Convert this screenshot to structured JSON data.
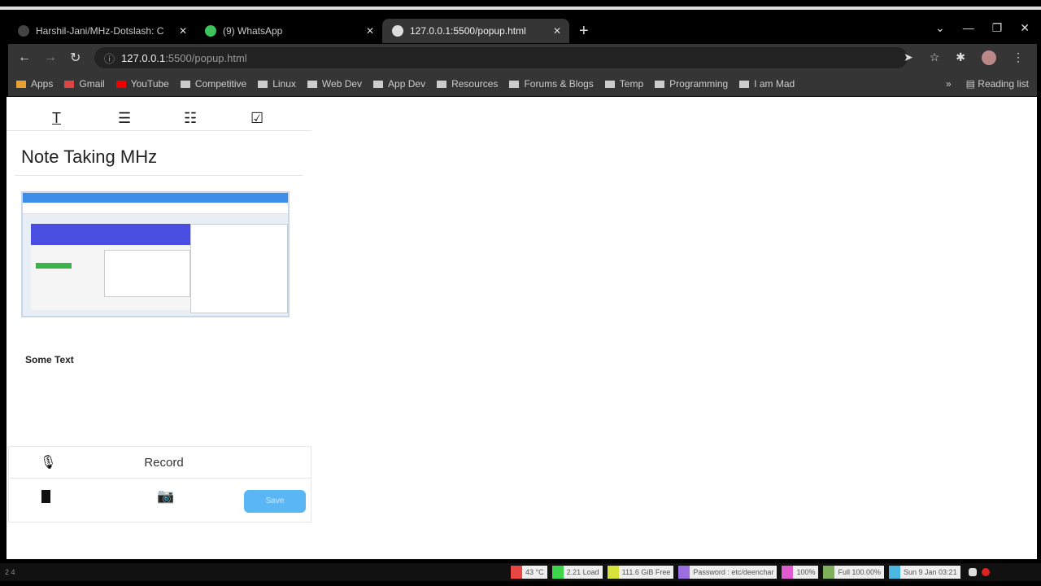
{
  "browser": {
    "tabs": [
      {
        "label": "Harshil-Jani/MHz-Dotslash: C",
        "active": false
      },
      {
        "label": "(9) WhatsApp",
        "active": false
      },
      {
        "label": "127.0.0.1:5500/popup.html",
        "active": true
      }
    ],
    "url_host": "127.0.0.1",
    "url_rest": ":5500/popup.html",
    "bookmarks": [
      "Apps",
      "Gmail",
      "YouTube",
      "Competitive",
      "Linux",
      "Web Dev",
      "App Dev",
      "Resources",
      "Forums & Blogs",
      "Temp",
      "Programming",
      "I am Mad"
    ],
    "reading_list": "Reading list"
  },
  "app": {
    "toolbar": [
      "text-format-icon",
      "bulleted-list-icon",
      "numbered-list-icon",
      "checkbox-icon"
    ],
    "title": "Note Taking MHz",
    "note_text": "Some Text",
    "record_label": "Record",
    "save_label": "Save",
    "accent": "#5ab6f5"
  },
  "statusbar": {
    "workspaces": "2  4",
    "items": [
      {
        "text": "43 °C",
        "color": "#e84545"
      },
      {
        "text": "2.21 Load",
        "color": "#3cd64a"
      },
      {
        "text": "111.6 GiB Free",
        "color": "#d6e23c"
      },
      {
        "text": "Password : etc/deenchar",
        "color": "#9b6fe0"
      },
      {
        "text": "100%",
        "color": "#e05bd0"
      },
      {
        "text": "Full 100.00%",
        "color": "#7fb05a"
      },
      {
        "text": "Sun 9 Jan 03:21",
        "color": "#4bb6e0"
      }
    ]
  }
}
